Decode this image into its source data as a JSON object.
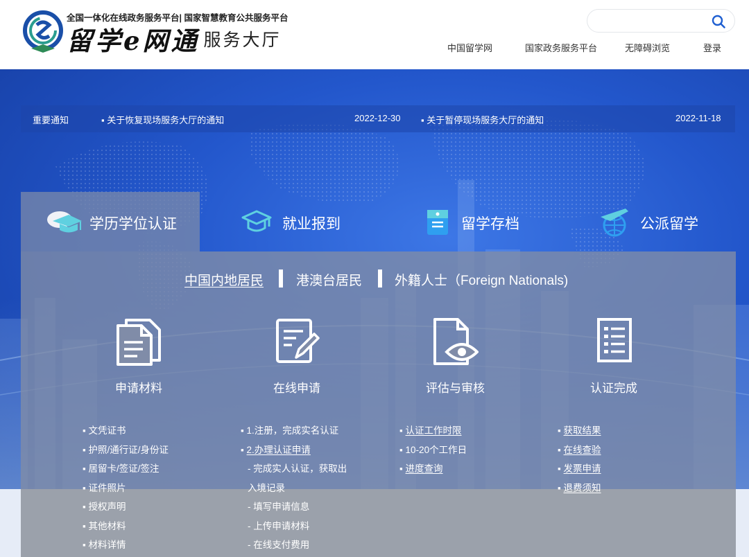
{
  "header": {
    "platform_line": "全国一体化在线政务服务平台| 国家智慧教育公共服务平台",
    "logo_brush": "留学e网通",
    "logo_hall": "服务大厅",
    "search": {
      "placeholder": "",
      "value": ""
    },
    "nav": [
      "中国留学网",
      "国家政务服务平台",
      "无障碍浏览",
      "登录"
    ]
  },
  "notices": {
    "label": "重要通知",
    "items": [
      {
        "title": "关于恢复现场服务大厅的通知",
        "date": "2022-12-30"
      },
      {
        "title": "关于暂停现场服务大厅的通知",
        "date": "2022-11-18"
      }
    ]
  },
  "tabs": [
    {
      "label": "学历学位认证",
      "icon": "graduation-cap-icon"
    },
    {
      "label": "就业报到",
      "icon": "mortarboard-outline-icon"
    },
    {
      "label": "留学存档",
      "icon": "archive-folder-icon"
    },
    {
      "label": "公派留学",
      "icon": "airplane-globe-icon"
    }
  ],
  "residents": [
    "中国内地居民",
    "港澳台居民",
    "外籍人士（Foreign Nationals)"
  ],
  "steps": [
    {
      "label": "申请材料",
      "icon": "documents-icon",
      "items": [
        "文凭证书",
        "护照/通行证/身份证",
        "居留卡/签证/签注",
        "证件照片",
        "授权声明",
        "其他材料",
        "材料详情"
      ]
    },
    {
      "label": "在线申请",
      "icon": "edit-form-icon",
      "items": [
        "1.注册，完成实名认证",
        "2.办理认证申请",
        "- 完成实人认证，获取出",
        "入境记录",
        "- 填写申请信息",
        "- 上传申请材料",
        "- 在线支付费用"
      ]
    },
    {
      "label": "评估与审核",
      "icon": "document-eye-icon",
      "items": [
        "认证工作时限",
        "10-20个工作日",
        "进度查询"
      ]
    },
    {
      "label": "认证完成",
      "icon": "checklist-icon",
      "items": [
        "获取结果",
        "在线查验",
        "发票申请",
        "退费须知"
      ]
    }
  ],
  "colors": {
    "hero_blue": "#2357cc",
    "panel": "#808ca8",
    "icon_cyan": "#5fd0e0"
  }
}
